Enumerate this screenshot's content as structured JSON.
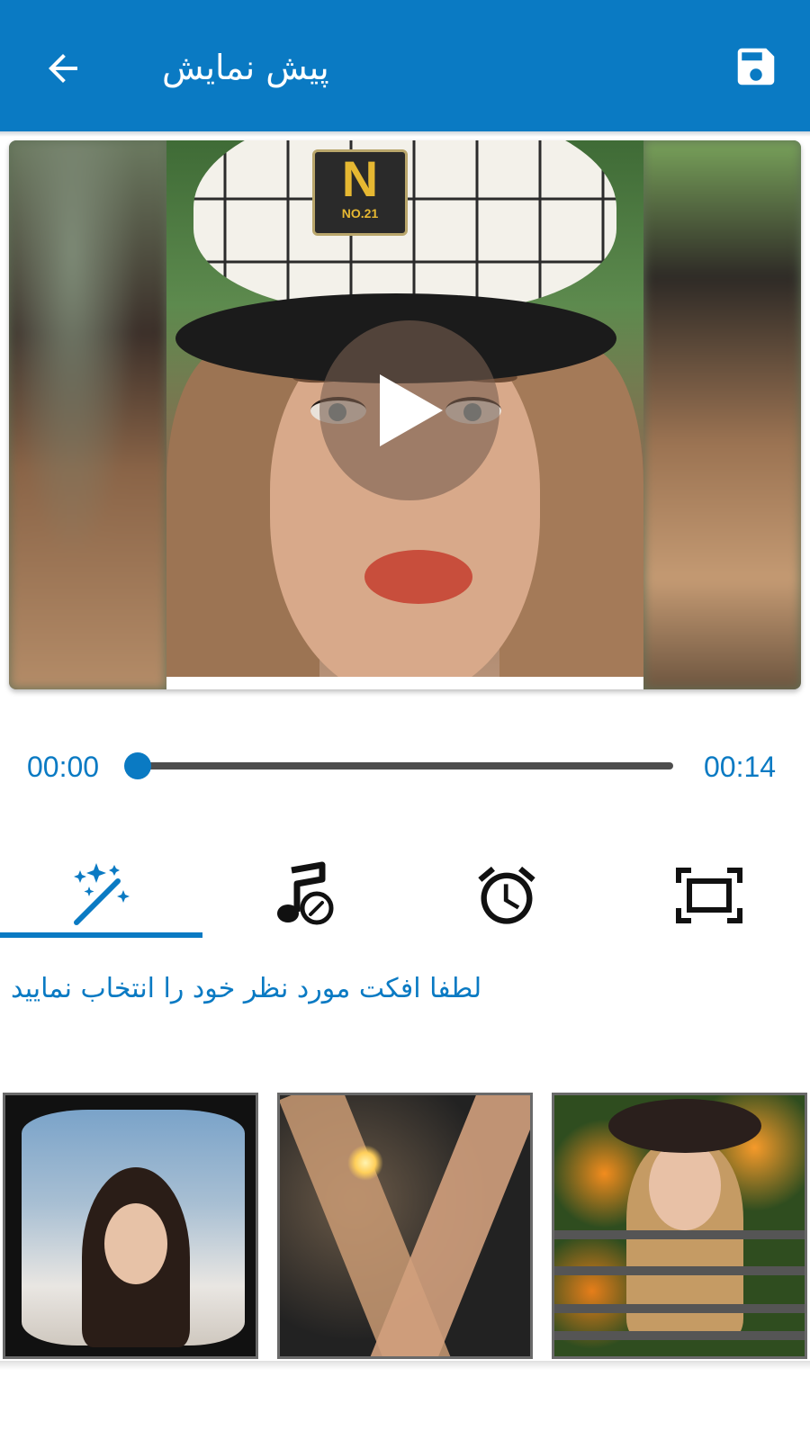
{
  "app_bar": {
    "title": "پیش نمایش",
    "back_icon": "arrow-left-icon",
    "save_icon": "floppy-disk-icon",
    "background_color": "#0a7ac3"
  },
  "preview": {
    "play_icon": "play-icon",
    "cap_badge_letter": "N",
    "cap_badge_text": "NO.21"
  },
  "player": {
    "current_time": "00:00",
    "total_time": "00:14",
    "progress": 0,
    "accent_color": "#0a7ac3"
  },
  "tabs": [
    {
      "icon": "magic-wand-icon",
      "selected": true
    },
    {
      "icon": "music-note-edit-icon",
      "selected": false
    },
    {
      "icon": "alarm-clock-icon",
      "selected": false
    },
    {
      "icon": "frame-icon",
      "selected": false
    }
  ],
  "hint_text": "لطفا افکت مورد نظر خود را انتخاب نمایید",
  "effects": [
    {
      "name": "curved-frame-effect"
    },
    {
      "name": "x-split-effect"
    },
    {
      "name": "strips-effect"
    }
  ]
}
